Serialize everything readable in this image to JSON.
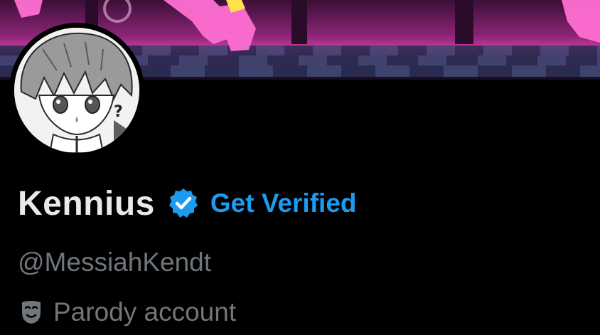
{
  "profile": {
    "display_name": "Kennius",
    "get_verified_label": "Get Verified",
    "handle": "@MessiahKendt",
    "parody_label": "Parody account"
  },
  "icons": {
    "verified": "verified-badge-icon",
    "parody": "theater-mask-icon"
  },
  "colors": {
    "background": "#000000",
    "name": "#e7e9ea",
    "secondary_text": "#71767b",
    "accent_blue": "#1d9bf0"
  }
}
